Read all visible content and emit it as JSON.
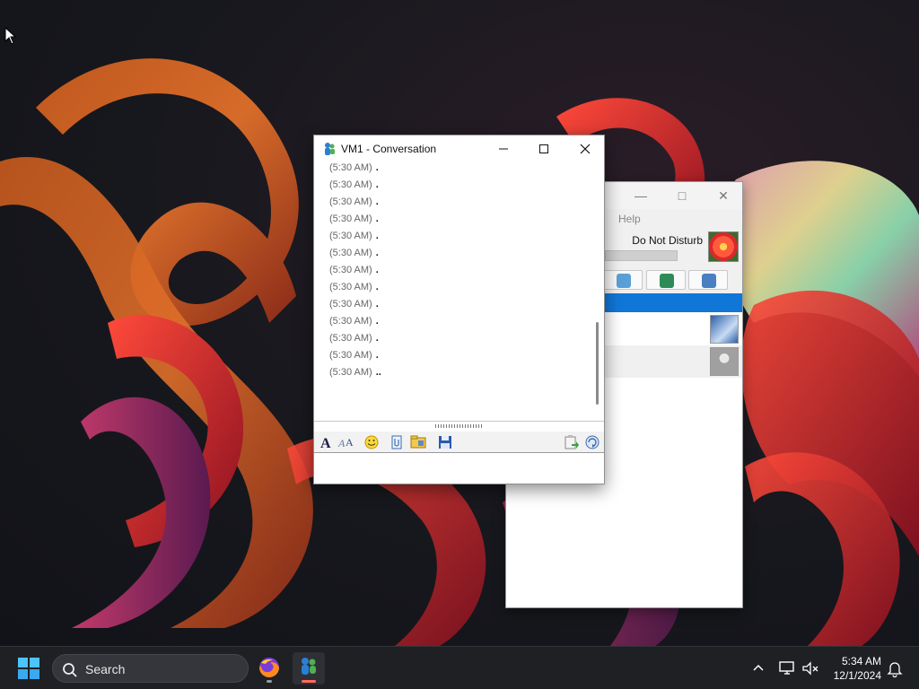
{
  "conversation": {
    "title": "VM1 - Conversation",
    "messages": [
      {
        "time": "(5:30 AM)",
        "text": "."
      },
      {
        "time": "(5:30 AM)",
        "text": "."
      },
      {
        "time": "(5:30 AM)",
        "text": "."
      },
      {
        "time": "(5:30 AM)",
        "text": "."
      },
      {
        "time": "(5:30 AM)",
        "text": "."
      },
      {
        "time": "(5:30 AM)",
        "text": "."
      },
      {
        "time": "(5:30 AM)",
        "text": "."
      },
      {
        "time": "(5:30 AM)",
        "text": "."
      },
      {
        "time": "(5:30 AM)",
        "text": "."
      },
      {
        "time": "(5:30 AM)",
        "text": "."
      },
      {
        "time": "(5:30 AM)",
        "text": "."
      },
      {
        "time": "(5:30 AM)",
        "text": "."
      },
      {
        "time": "(5:30 AM)",
        "text": "."
      },
      {
        "time": "(5:30 AM)",
        "text": "."
      },
      {
        "time": "(5:30 AM)",
        "text": ".."
      }
    ],
    "input_value": ""
  },
  "main_window": {
    "menu_help": "Help",
    "status": "Do Not Disturb"
  },
  "taskbar": {
    "search_label": "Search",
    "time": "5:34 AM",
    "date": "12/1/2024"
  },
  "colors": {
    "selection": "#1077d8",
    "taskbar": "#1f2024",
    "accent_indicator": "#ff6b5a"
  }
}
